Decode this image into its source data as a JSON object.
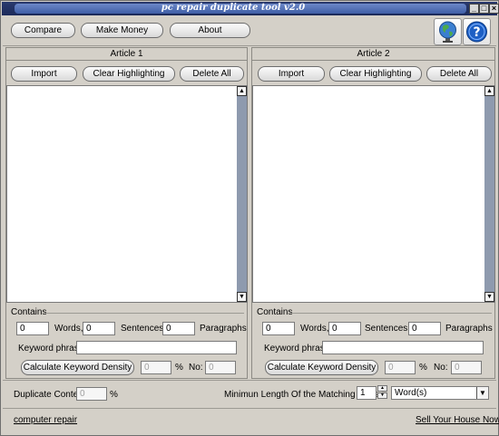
{
  "window": {
    "title": "pc repair duplicate tool v2.0"
  },
  "toolbar": {
    "compare_label": "Compare",
    "make_money_label": "Make Money",
    "about_label": "About"
  },
  "articles": [
    {
      "header": "Article 1",
      "import_label": "Import",
      "clear_label": "Clear Highlighting",
      "delete_label": "Delete All",
      "contains_label": "Contains",
      "words_value": "0",
      "words_label": "Words,",
      "sentences_value": "0",
      "sentences_label": "Sentences,",
      "paragraphs_value": "0",
      "paragraphs_label": "Paragraphs",
      "keyword_label": "Keyword phrase:",
      "keyword_value": "",
      "calc_label": "Calculate Keyword Density",
      "density_value": "0",
      "percent_label": "%",
      "no_label": "No:",
      "no_value": "0"
    },
    {
      "header": "Article 2",
      "import_label": "Import",
      "clear_label": "Clear Highlighting",
      "delete_label": "Delete All",
      "contains_label": "Contains",
      "words_value": "0",
      "words_label": "Words,",
      "sentences_value": "0",
      "sentences_label": "Sentences,",
      "paragraphs_value": "0",
      "paragraphs_label": "Paragraphs",
      "keyword_label": "Keyword phrase:",
      "keyword_value": "",
      "calc_label": "Calculate Keyword Density",
      "density_value": "0",
      "percent_label": "%",
      "no_label": "No:",
      "no_value": "0"
    }
  ],
  "bottom": {
    "duplicate_label": "Duplicate Content",
    "duplicate_value": "0",
    "duplicate_percent": "%",
    "min_length_label": "Minimun Length Of the Matching Parts =",
    "min_length_value": "1",
    "unit_selected": "Word(s)"
  },
  "footer": {
    "left_link": "computer repair",
    "right_link": "Sell Your House Now"
  },
  "icons": {
    "globe": "globe-icon",
    "help": "help-icon"
  }
}
